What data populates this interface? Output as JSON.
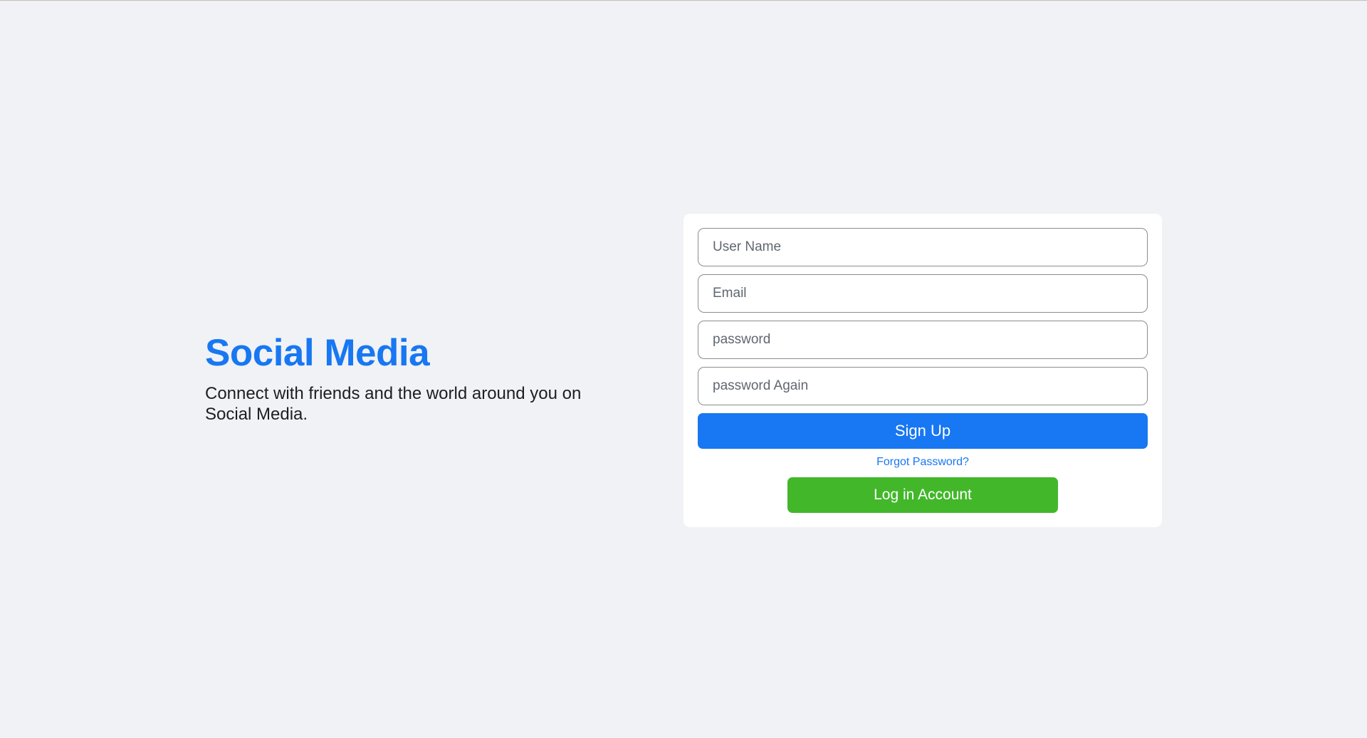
{
  "brand": {
    "title": "Social Media",
    "tagline": "Connect with friends and the world around you on Social Media."
  },
  "form": {
    "username": {
      "placeholder": "User Name",
      "value": ""
    },
    "email": {
      "placeholder": "Email",
      "value": ""
    },
    "password": {
      "placeholder": "password",
      "value": ""
    },
    "password_again": {
      "placeholder": "password Again",
      "value": ""
    },
    "signup_label": "Sign Up",
    "forgot_label": "Forgot Password?",
    "login_label": "Log in Account"
  },
  "colors": {
    "background": "#f0f2f5",
    "primary": "#1877f2",
    "success": "#42b72a",
    "card": "#ffffff"
  }
}
